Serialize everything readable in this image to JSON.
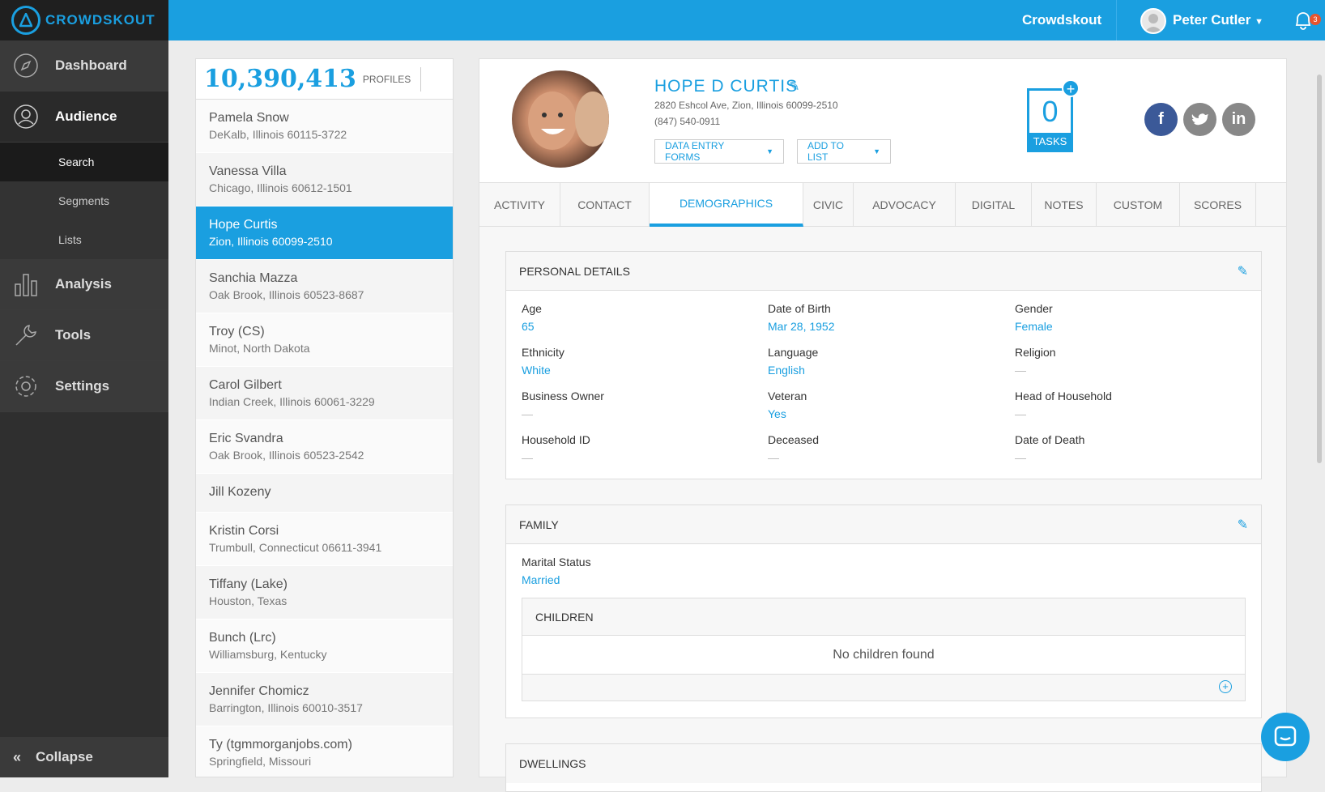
{
  "app": {
    "logo_text": "CROWDSKOUT",
    "org": "Crowdskout",
    "user": "Peter Cutler",
    "notifications": "3"
  },
  "nav": {
    "dashboard": "Dashboard",
    "audience": "Audience",
    "search": "Search",
    "segments": "Segments",
    "lists": "Lists",
    "analysis": "Analysis",
    "tools": "Tools",
    "settings": "Settings",
    "collapse": "Collapse"
  },
  "list": {
    "count": "10,390,413",
    "count_label": "PROFILES",
    "rows": [
      {
        "name": "Pamela Snow",
        "addr": "DeKalb, Illinois 60115-3722"
      },
      {
        "name": "Vanessa Villa",
        "addr": "Chicago, Illinois 60612-1501"
      },
      {
        "name": "Hope Curtis",
        "addr": "Zion, Illinois 60099-2510"
      },
      {
        "name": "Sanchia Mazza",
        "addr": "Oak Brook, Illinois 60523-8687"
      },
      {
        "name": "Troy (CS)",
        "addr": "Minot, North Dakota"
      },
      {
        "name": "Carol Gilbert",
        "addr": "Indian Creek, Illinois 60061-3229"
      },
      {
        "name": "Eric Svandra",
        "addr": "Oak Brook, Illinois 60523-2542"
      },
      {
        "name": "Jill Kozeny",
        "addr": ""
      },
      {
        "name": "Kristin Corsi",
        "addr": "Trumbull, Connecticut 06611-3941"
      },
      {
        "name": "Tiffany (Lake)",
        "addr": "Houston, Texas"
      },
      {
        "name": "Bunch (Lrc)",
        "addr": "Williamsburg, Kentucky"
      },
      {
        "name": "Jennifer Chomicz",
        "addr": "Barrington, Illinois 60010-3517"
      },
      {
        "name": "Ty (tgmmorganjobs.com)",
        "addr": "Springfield, Missouri"
      }
    ]
  },
  "profile": {
    "name": "HOPE D CURTIS",
    "address": "2820 Eshcol Ave, Zion, Illinois 60099-2510",
    "phone": "(847) 540-0911",
    "btn_forms": "DATA ENTRY FORMS",
    "btn_list": "ADD TO LIST",
    "tasks_count": "0",
    "tasks_label": "TASKS",
    "social": {
      "facebook": "f",
      "twitter": "t",
      "linkedin": "in"
    }
  },
  "tabs": [
    "ACTIVITY",
    "CONTACT",
    "DEMOGRAPHICS",
    "CIVIC",
    "ADVOCACY",
    "DIGITAL",
    "NOTES",
    "CUSTOM",
    "SCORES"
  ],
  "personal": {
    "title": "PERSONAL DETAILS",
    "fields": [
      {
        "label": "Age",
        "value": "65"
      },
      {
        "label": "Date of Birth",
        "value": "Mar 28, 1952"
      },
      {
        "label": "Gender",
        "value": "Female"
      },
      {
        "label": "Ethnicity",
        "value": "White"
      },
      {
        "label": "Language",
        "value": "English"
      },
      {
        "label": "Religion",
        "value": "—"
      },
      {
        "label": "Business Owner",
        "value": "—"
      },
      {
        "label": "Veteran",
        "value": "Yes"
      },
      {
        "label": "Head of Household",
        "value": "—"
      },
      {
        "label": "Household ID",
        "value": "—"
      },
      {
        "label": "Deceased",
        "value": "—"
      },
      {
        "label": "Date of Death",
        "value": "—"
      }
    ]
  },
  "family": {
    "title": "FAMILY",
    "marital_label": "Marital Status",
    "marital_value": "Married",
    "children_title": "CHILDREN",
    "no_children": "No children found"
  },
  "dwellings": {
    "title": "DWELLINGS"
  },
  "colors": {
    "accent": "#1a9fe0",
    "sidebar": "#2f2f2f",
    "facebook": "#3b5998",
    "twitter": "#888888",
    "linkedin": "#888888"
  }
}
